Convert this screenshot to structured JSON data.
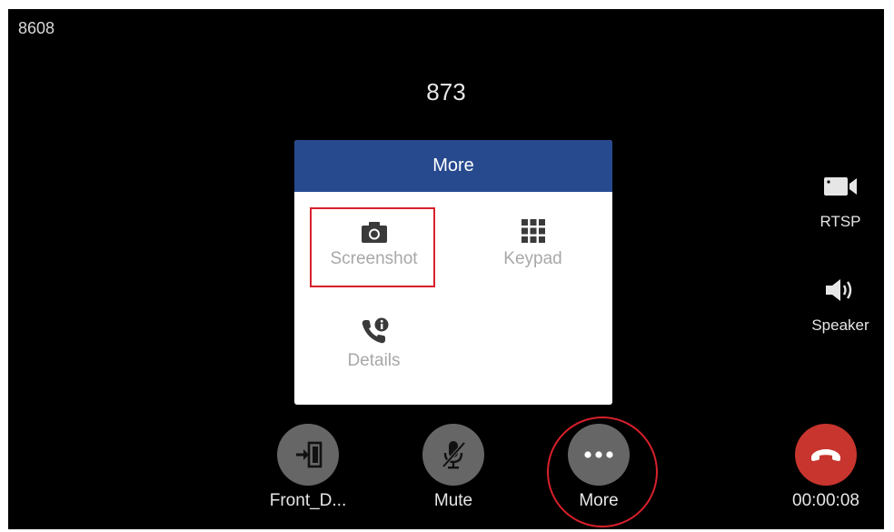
{
  "status": {
    "extension": "8608",
    "remote_number": "873"
  },
  "dialog": {
    "title": "More",
    "items": [
      {
        "label": "Screenshot",
        "icon": "camera-icon"
      },
      {
        "label": "Keypad",
        "icon": "keypad-icon"
      },
      {
        "label": "Details",
        "icon": "call-details-icon"
      }
    ],
    "highlighted_item": "Screenshot"
  },
  "side_controls": [
    {
      "label": "RTSP",
      "icon": "video-camera-icon"
    },
    {
      "label": "Speaker",
      "icon": "speaker-icon"
    }
  ],
  "bottom_buttons": [
    {
      "label": "Front_D...",
      "icon": "door-enter-icon"
    },
    {
      "label": "Mute",
      "icon": "mic-muted-icon"
    },
    {
      "label": "More",
      "icon": "more-dots-icon"
    }
  ],
  "call_timer": "00:00:08",
  "colors": {
    "dialog_header": "#274a8f",
    "highlight": "#d8202c",
    "hangup": "#c7352e",
    "button_gray": "#666666"
  }
}
